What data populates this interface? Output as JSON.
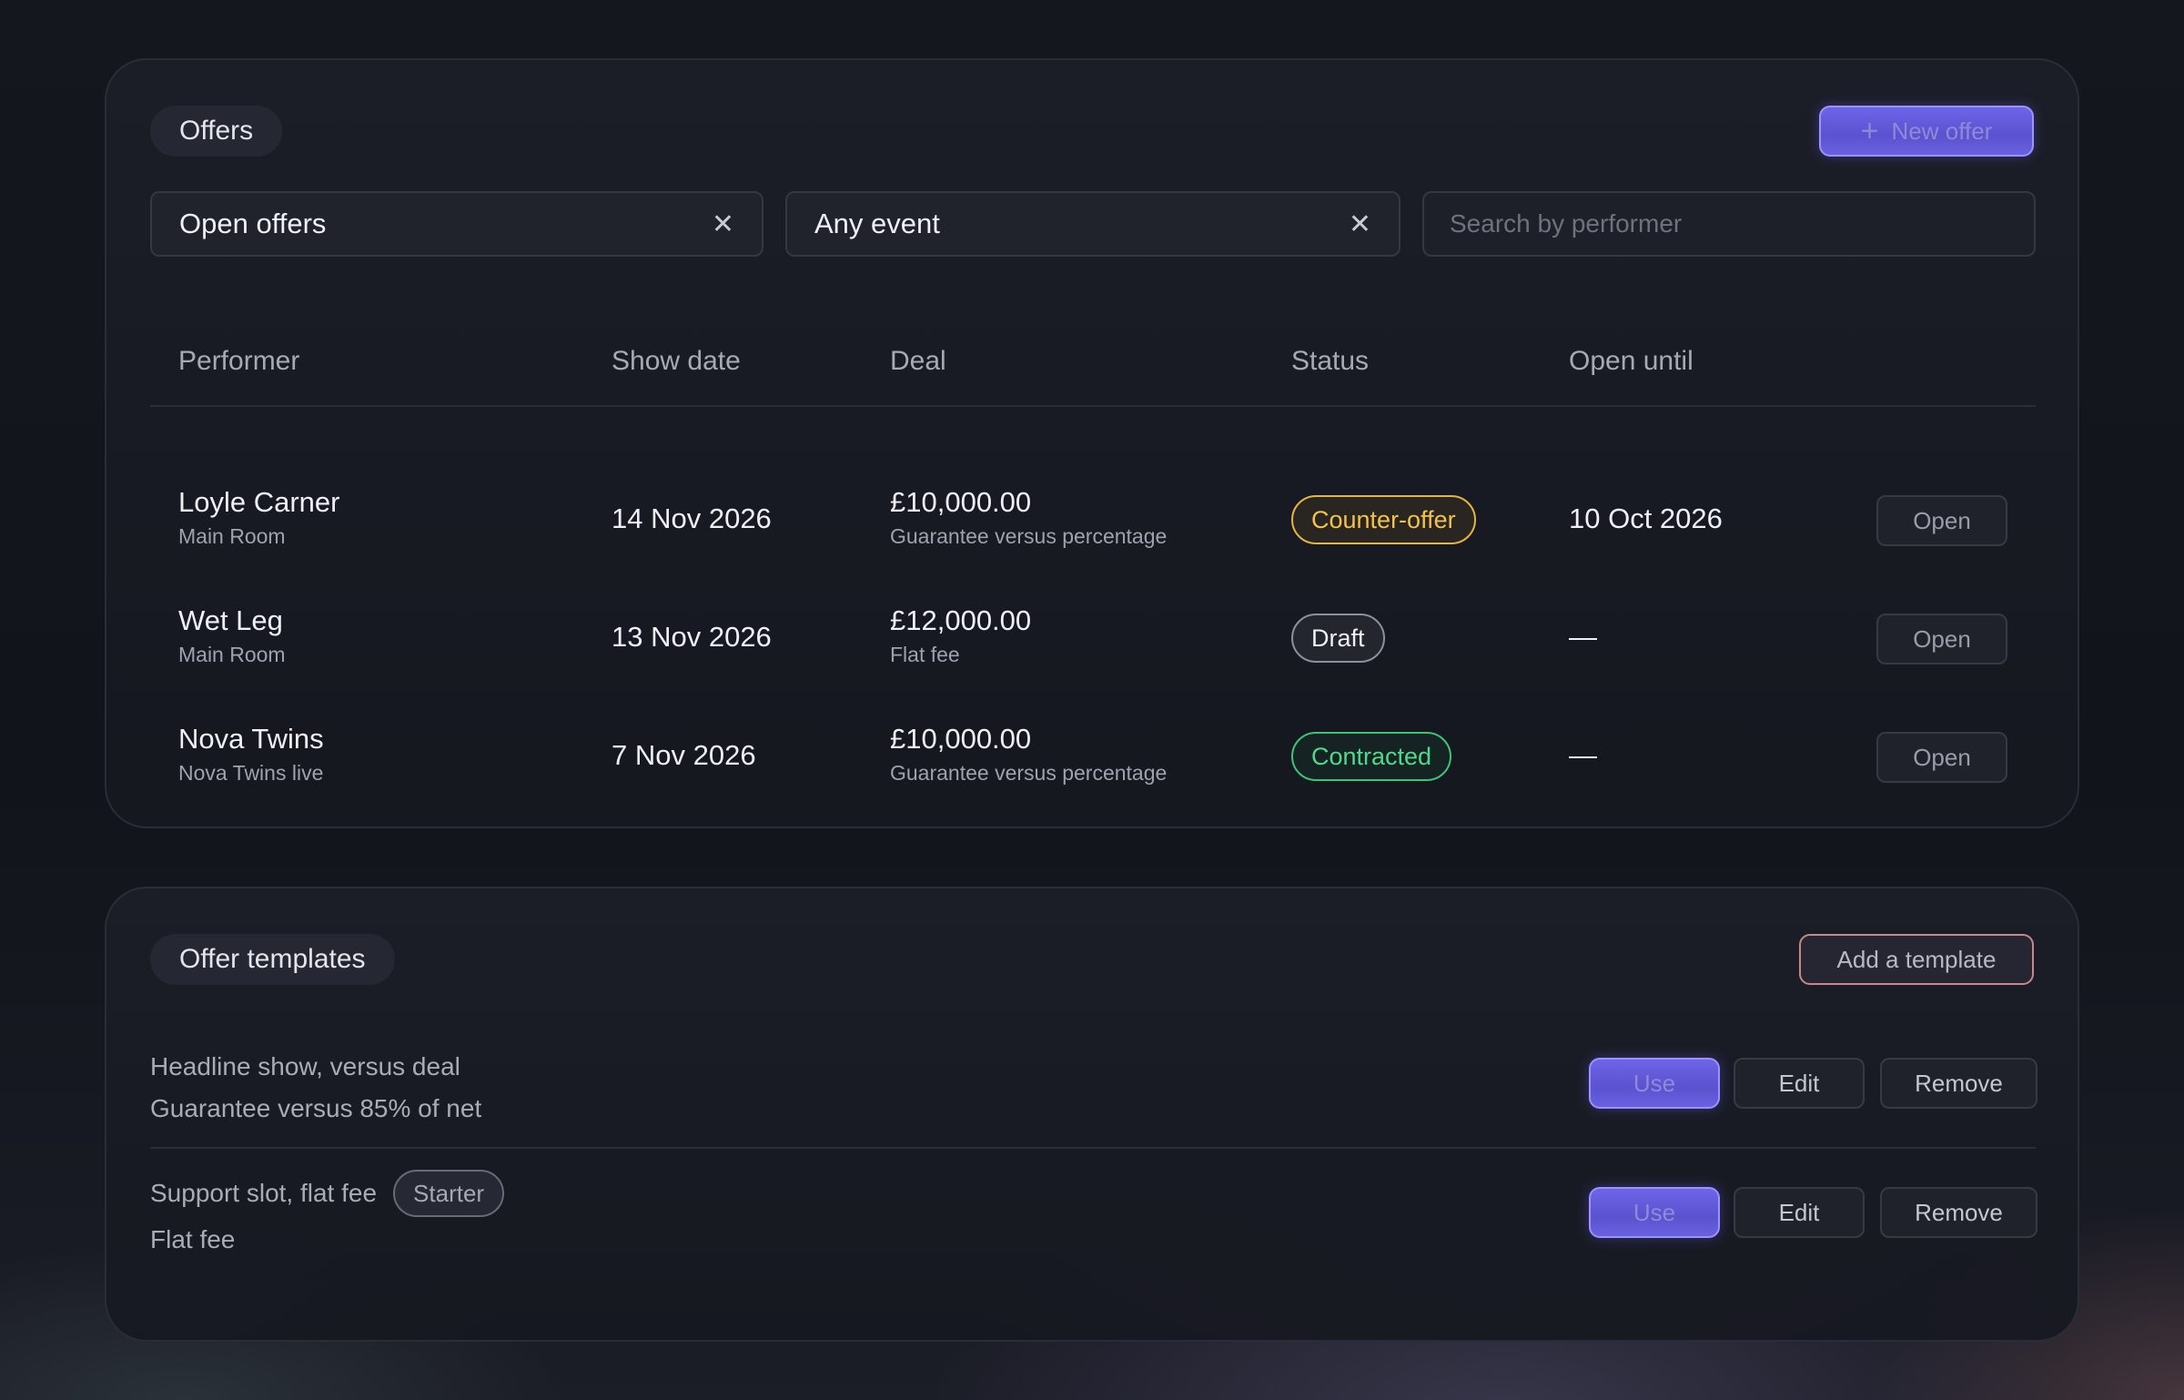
{
  "offers": {
    "title": "Offers",
    "new_offer_label": "New offer",
    "filters": {
      "status_value": "Open offers",
      "event_value": "Any event",
      "search_placeholder": "Search by performer"
    },
    "columns": [
      "Performer",
      "Show date",
      "Deal",
      "Status",
      "Open until"
    ],
    "rows": [
      {
        "performer": "Loyle Carner",
        "venue": "Main Room",
        "show_date": "14 Nov 2026",
        "deal_amount": "£10,000.00",
        "deal_type": "Guarantee versus percentage",
        "status": "Counter-offer",
        "open_until": "10 Oct 2026",
        "action": "Open"
      },
      {
        "performer": "Wet Leg",
        "venue": "Main Room",
        "show_date": "13 Nov 2026",
        "deal_amount": "£12,000.00",
        "deal_type": "Flat fee",
        "status": "Draft",
        "open_until": "—",
        "action": "Open"
      },
      {
        "performer": "Nova Twins",
        "venue": "Nova Twins live",
        "show_date": "7 Nov 2026",
        "deal_amount": "£10,000.00",
        "deal_type": "Guarantee versus percentage",
        "status": "Contracted",
        "open_until": "—",
        "action": "Open"
      }
    ],
    "status_colors": {
      "Counter-offer": "#f2c14e",
      "Draft": "#eef0f6",
      "Contracted": "#4fd98a"
    }
  },
  "templates": {
    "title": "Offer templates",
    "add_label": "Add a template",
    "items": [
      {
        "name": "Headline show, versus deal",
        "description": "Guarantee versus 85% of net",
        "tag": "",
        "use_label": "Use",
        "edit_label": "Edit",
        "remove_label": "Remove"
      },
      {
        "name": "Support slot, flat fee",
        "description": "Flat fee",
        "tag": "Starter",
        "use_label": "Use",
        "edit_label": "Edit",
        "remove_label": "Remove"
      }
    ]
  },
  "colors": {
    "accent": "#6d64e8",
    "background": "#14161d"
  }
}
